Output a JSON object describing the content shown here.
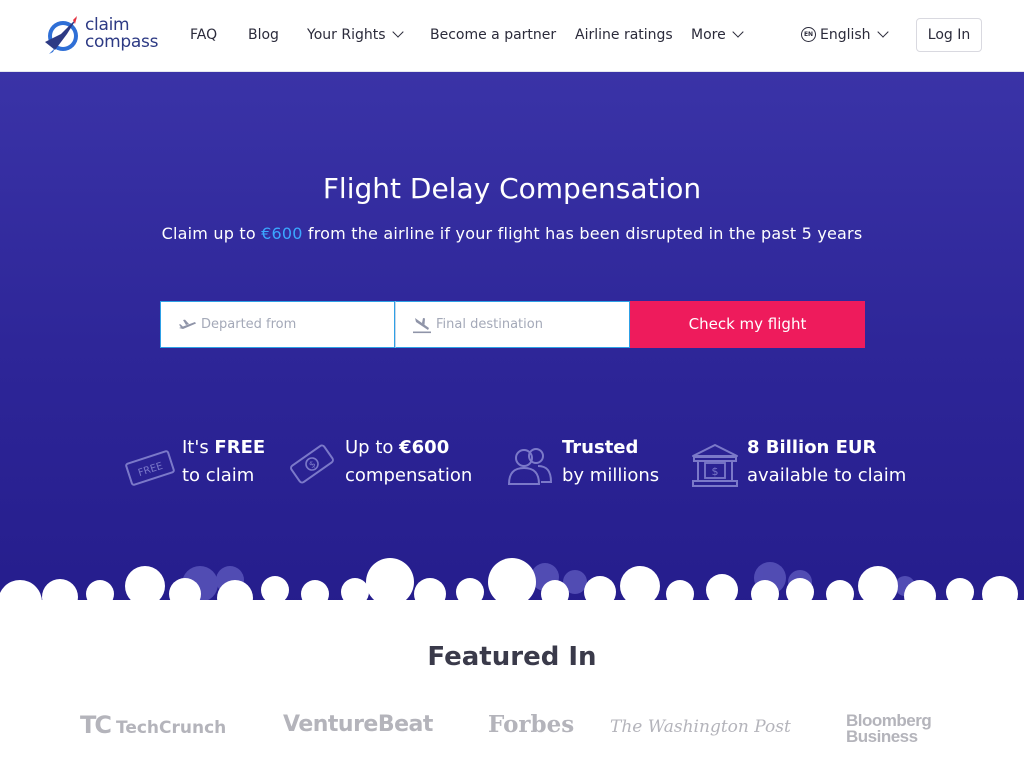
{
  "brand": {
    "name_line1": "claim",
    "name_line2": "compass",
    "logo_icon": "compass-plane-logo"
  },
  "nav": {
    "faq": "FAQ",
    "blog": "Blog",
    "your_rights": "Your Rights",
    "become_partner": "Become a partner",
    "airline_ratings": "Airline ratings",
    "more": "More",
    "language_badge": "EN",
    "language": "English",
    "login": "Log In"
  },
  "hero": {
    "title": "Flight Delay Compensation",
    "sub_prefix": "Claim up to ",
    "sub_amount": "€600",
    "sub_suffix": " from the airline if your flight has been disrupted in the past 5 years",
    "departed_placeholder": "Departed from",
    "destination_placeholder": "Final destination",
    "check_button": "Check my flight"
  },
  "features": [
    {
      "icon": "free-ticket-icon",
      "pre": "It's ",
      "bold": "FREE",
      "line2": "to claim",
      "badge": "FREE"
    },
    {
      "icon": "money-bill-icon",
      "pre": "Up to ",
      "bold": "€600",
      "line2": "compensation"
    },
    {
      "icon": "people-icon",
      "pre": "",
      "bold": "Trusted",
      "line2": "by millions"
    },
    {
      "icon": "bank-icon",
      "pre": "",
      "bold": "8 Billion EUR",
      "line2": "available to claim"
    }
  ],
  "featured": {
    "title": "Featured In",
    "logos": {
      "techcrunch": "TechCrunch",
      "techcrunch_mark": "TC",
      "venturebeat": "VentureBeat",
      "forbes": "Forbes",
      "washington_post": "The Washington Post",
      "bloomberg_line1": "Bloomberg",
      "bloomberg_line2": "Business"
    }
  },
  "colors": {
    "hero_bg": "#2d2597",
    "accent_pink": "#ee1b5c",
    "accent_blue": "#3ba7ff",
    "brand_navy": "#2d3a84"
  }
}
